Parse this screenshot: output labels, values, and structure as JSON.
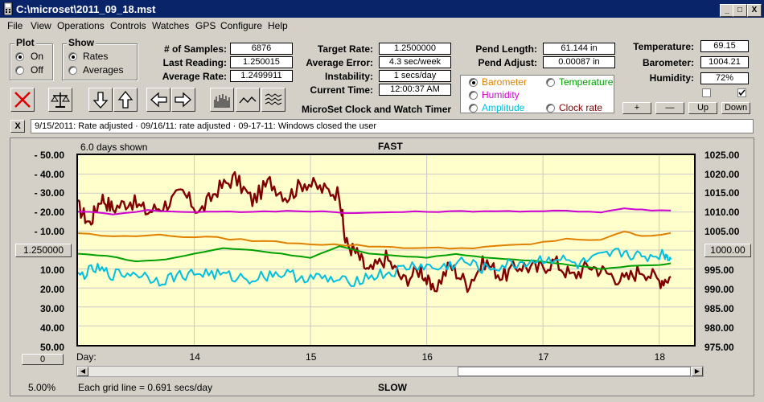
{
  "window": {
    "title": "C:\\microset\\2011_09_18.mst",
    "controls": [
      "_",
      "□",
      "X"
    ]
  },
  "menu": [
    "File",
    "View",
    "Operations",
    "Controls",
    "Watches",
    "GPS",
    "Configure",
    "Help"
  ],
  "plot_group": {
    "label": "Plot",
    "options": [
      "On",
      "Off"
    ],
    "selected": "On"
  },
  "show_group": {
    "label": "Show",
    "options": [
      "Rates",
      "Averages"
    ],
    "selected": "Rates"
  },
  "stats": {
    "samples_label": "# of Samples:",
    "samples": "6876",
    "last_label": "Last Reading:",
    "last": "1.250015",
    "avg_label": "Average Rate:",
    "avg": "1.2499911",
    "target_label": "Target Rate:",
    "target": "1.2500000",
    "avg_error_label": "Average Error:",
    "avg_error": "4.3 sec/week",
    "instability_label": "Instability:",
    "instability": "1 secs/day",
    "time_label": "Current Time:",
    "time": "12:00:37 AM",
    "pend_length_label": "Pend Length:",
    "pend_length": "61.144 in",
    "pend_adjust_label": "Pend Adjust:",
    "pend_adjust": "0.00087 in",
    "temperature_label": "Temperature:",
    "temperature": "69.15",
    "barometer_label": "Barometer:",
    "barometer": "1004.21",
    "humidity_label": "Humidity:",
    "humidity": "72%"
  },
  "app_title": "MicroSet Clock and Watch Timer",
  "sensor_options": [
    {
      "label": "Barometer",
      "color": "#e08000",
      "selected": true
    },
    {
      "label": "Temperature",
      "color": "#00a000",
      "selected": false
    },
    {
      "label": "Humidity",
      "color": "#d000d0",
      "selected": false
    },
    {
      "label": "Clock rate",
      "color": "#800000",
      "selected": false
    },
    {
      "label": "Amplitude",
      "color": "#00c0e0",
      "selected": false
    }
  ],
  "small_buttons": [
    "+",
    "—",
    "Up",
    "Down"
  ],
  "message": "9/15/2011: Rate adjusted  ·  09/16/11: rate adjusted  ·  09-17-11: Windows closed the user",
  "close_label": "X",
  "chart_data": {
    "type": "line",
    "days_shown": "6.0 days shown",
    "top_label": "FAST",
    "bottom_label": "SLOW",
    "center_rate": "1.250000",
    "center_right": "1000.00",
    "bottom_button": "0",
    "scale_pct": "5.00%",
    "grid_note": "Each grid line = 0.691 secs/day",
    "x_label": "Day:",
    "x_ticks": [
      {
        "label": "14",
        "day": 14
      },
      {
        "label": "15",
        "day": 15
      },
      {
        "label": "16",
        "day": 16
      },
      {
        "label": "17",
        "day": 17
      },
      {
        "label": "18",
        "day": 18
      }
    ],
    "x_range": [
      13.0,
      18.3
    ],
    "y_left_ticks": [
      "- 50.00",
      "- 40.00",
      "- 30.00",
      "- 20.00",
      "- 10.00",
      "10.00",
      "20.00",
      "30.00",
      "40.00",
      "50.00"
    ],
    "y_right_ticks": [
      "1025.00",
      "1020.00",
      "1015.00",
      "1010.00",
      "1005.00",
      "995.00",
      "990.00",
      "985.00",
      "980.00",
      "975.00"
    ],
    "y_right_range": [
      975,
      1025
    ],
    "series": [
      {
        "name": "Clock rate",
        "color": "#800000",
        "x": [
          13.0,
          13.1,
          13.2,
          13.3,
          13.45,
          13.6,
          13.75,
          13.9,
          14.05,
          14.2,
          14.35,
          14.5,
          14.65,
          14.8,
          14.95,
          15.1,
          15.25,
          15.3,
          15.4,
          15.5,
          15.65,
          15.8,
          15.95,
          16.05,
          16.2,
          16.35,
          16.5,
          16.65,
          16.8,
          16.95,
          17.1,
          17.25,
          17.4,
          17.55,
          17.7,
          17.85,
          18.0,
          18.1
        ],
        "y": [
          1011.5,
          1007,
          1014,
          1011,
          1013,
          1010,
          1012,
          1015,
          1010,
          1016,
          1019,
          1013,
          1018,
          1014,
          1018,
          1016,
          1015,
          1002,
          999,
          994,
          998,
          992,
          995,
          989,
          996,
          991,
          997,
          993,
          996,
          995,
          997,
          993,
          996,
          994,
          992,
          995,
          992,
          993
        ]
      },
      {
        "name": "Humidity",
        "color": "#d000d0",
        "x": [
          13.0,
          13.3,
          13.6,
          13.9,
          14.2,
          14.5,
          14.8,
          15.1,
          15.4,
          15.7,
          16.0,
          16.3,
          16.6,
          16.9,
          17.2,
          17.5,
          17.7,
          17.85,
          18.1
        ],
        "y": [
          1010.2,
          1009.5,
          1010.5,
          1010,
          1010.2,
          1010,
          1010.3,
          1010.2,
          1009.7,
          1010,
          1010.1,
          1010.2,
          1010.3,
          1010.1,
          1010.4,
          1010,
          1011,
          1010.6,
          1010.4
        ]
      },
      {
        "name": "Barometer",
        "color": "#e08000",
        "x": [
          13.0,
          13.3,
          13.6,
          13.9,
          14.2,
          14.5,
          14.8,
          15.1,
          15.4,
          15.7,
          16.0,
          16.3,
          16.6,
          16.9,
          17.2,
          17.5,
          17.7,
          17.85,
          18.1
        ],
        "y": [
          1004.5,
          1003.5,
          1004,
          1003.6,
          1003.2,
          1002.5,
          1002,
          1001.5,
          1001.2,
          1000.8,
          1000.5,
          1000.5,
          1001,
          1001.5,
          1003,
          1002.5,
          1005,
          1003.5,
          1004.5
        ]
      },
      {
        "name": "Temperature",
        "color": "#00a000",
        "x": [
          13.0,
          13.25,
          13.5,
          13.75,
          14.0,
          14.25,
          14.5,
          14.75,
          15.0,
          15.25,
          15.5,
          15.75,
          16.0,
          16.25,
          16.5,
          16.75,
          17.0,
          17.25,
          17.5,
          17.75,
          18.0,
          18.1
        ],
        "y": [
          999,
          998.5,
          997,
          997.5,
          999,
          1000.5,
          1000,
          999,
          998,
          1001,
          999,
          998.5,
          998,
          999,
          998,
          997.5,
          997,
          996,
          995,
          995.8,
          996,
          996.5
        ]
      },
      {
        "name": "Amplitude",
        "color": "#00c0e0",
        "x": [
          13.0,
          13.15,
          13.3,
          13.5,
          13.7,
          13.9,
          14.1,
          14.3,
          14.5,
          14.7,
          14.9,
          15.1,
          15.3,
          15.5,
          15.7,
          15.9,
          16.1,
          16.3,
          16.5,
          16.7,
          16.9,
          17.1,
          17.3,
          17.5,
          17.7,
          17.85,
          18.05,
          18.1
        ],
        "y": [
          993,
          995,
          993.5,
          994,
          992,
          993.5,
          994,
          993,
          992.5,
          994,
          993,
          992.5,
          991.5,
          993,
          994,
          996,
          995,
          997,
          995,
          996,
          997,
          998,
          996,
          998,
          999.5,
          998,
          999,
          997.5
        ]
      }
    ]
  }
}
